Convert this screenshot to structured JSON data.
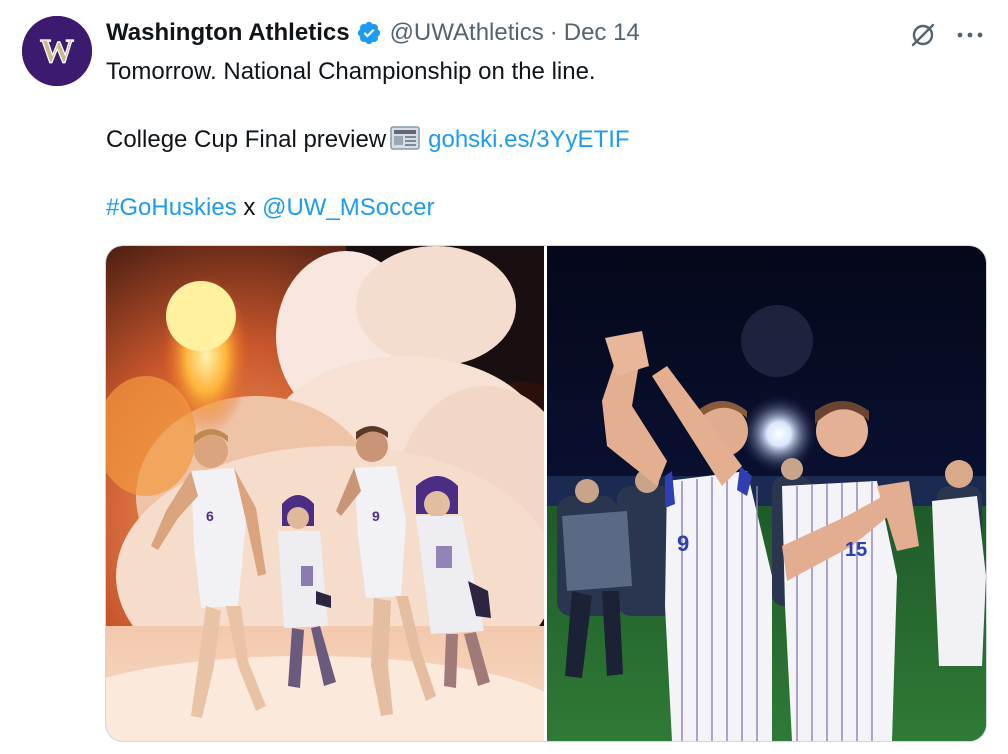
{
  "tweet": {
    "author": {
      "display_name": "Washington Athletics",
      "handle": "@UWAthletics",
      "verified": true,
      "avatar_letter": "W"
    },
    "separator": "·",
    "date": "Dec 14",
    "lines": {
      "line1": "Tomorrow. National Championship on the line.",
      "line2_text": "College Cup Final preview",
      "line2_link": "gohski.es/3YyETIF",
      "line3_hashtag": "#GoHuskies",
      "line3_x": "x",
      "line3_mention": "@UW_MSoccer"
    },
    "media": [
      {
        "icon": "photo-players-walking-out-with-smoke"
      },
      {
        "icon": "photo-players-clapping-at-night"
      }
    ]
  },
  "icons": {
    "verified": "verified-badge-icon",
    "news": "newspaper-icon",
    "grok": "grok-icon",
    "more": "more-dots-icon"
  },
  "colors": {
    "link": "#1d9bf0",
    "secondary_text": "#536471",
    "avatar_bg": "#3b1a70",
    "avatar_letter": "#c9b98f"
  }
}
